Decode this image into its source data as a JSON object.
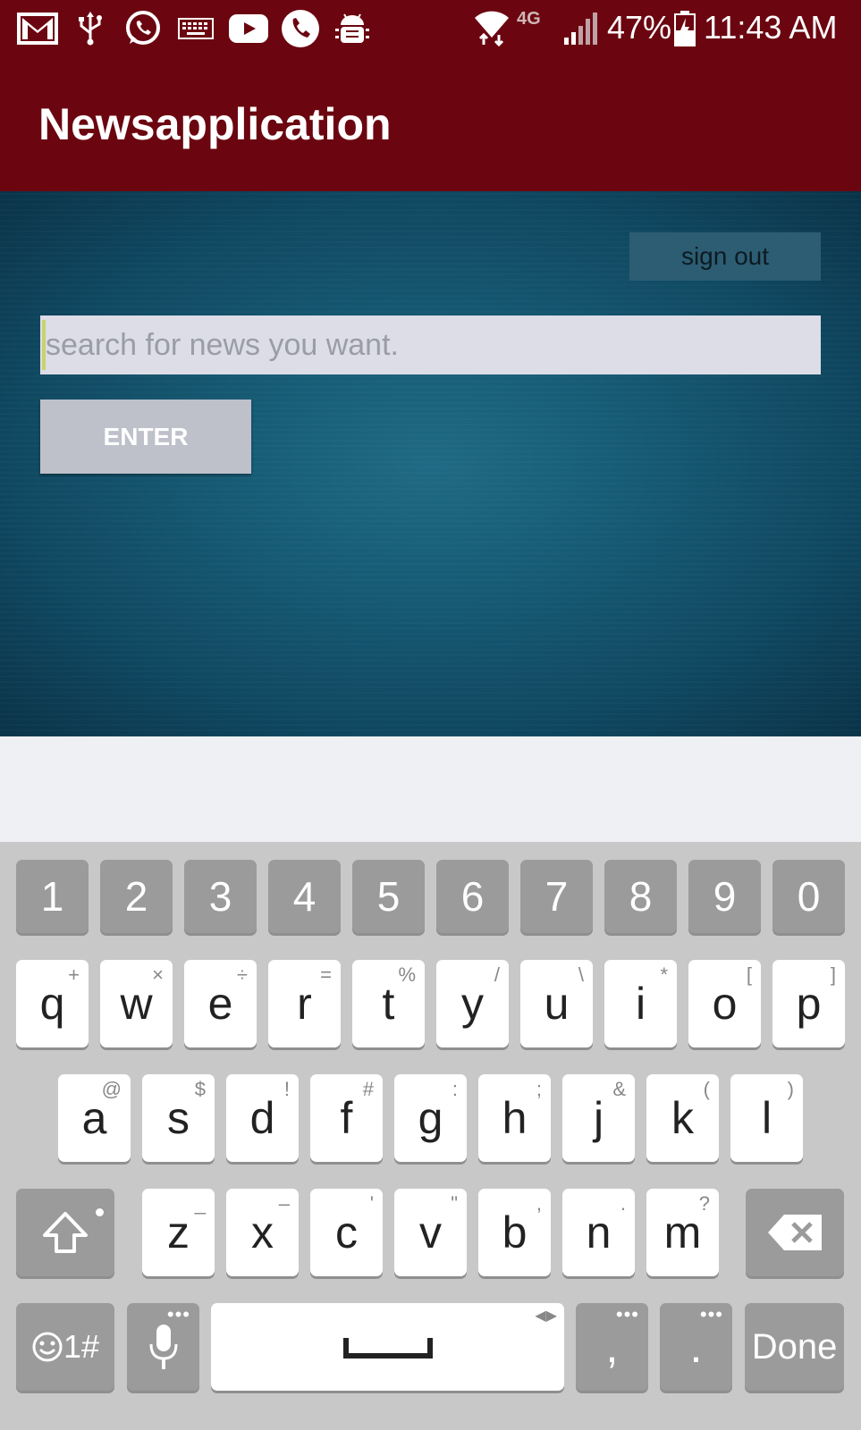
{
  "status_bar": {
    "icons": [
      "gmail-icon",
      "usb-icon",
      "whatsapp-icon",
      "keyboard-icon",
      "youtube-icon",
      "phone-icon",
      "android-debug-icon",
      "wifi-icon",
      "lte-4g-icon",
      "signal-icon",
      "battery-icon"
    ],
    "network": "4G",
    "battery_percent": "47%",
    "time": "11:43 AM"
  },
  "app_bar": {
    "title": "Newsapplication"
  },
  "main": {
    "sign_out_label": "sign out",
    "search_placeholder": "search for news you want.",
    "enter_label": "ENTER"
  },
  "keyboard": {
    "numbers": [
      "1",
      "2",
      "3",
      "4",
      "5",
      "6",
      "7",
      "8",
      "9",
      "0"
    ],
    "row1": [
      {
        "key": "q",
        "alt": "+"
      },
      {
        "key": "w",
        "alt": "×"
      },
      {
        "key": "e",
        "alt": "÷"
      },
      {
        "key": "r",
        "alt": "="
      },
      {
        "key": "t",
        "alt": "%"
      },
      {
        "key": "y",
        "alt": "/"
      },
      {
        "key": "u",
        "alt": "\\"
      },
      {
        "key": "i",
        "alt": "*"
      },
      {
        "key": "o",
        "alt": "["
      },
      {
        "key": "p",
        "alt": "]"
      }
    ],
    "row2": [
      {
        "key": "a",
        "alt": "@"
      },
      {
        "key": "s",
        "alt": "$"
      },
      {
        "key": "d",
        "alt": "!"
      },
      {
        "key": "f",
        "alt": "#"
      },
      {
        "key": "g",
        "alt": ":"
      },
      {
        "key": "h",
        "alt": ";"
      },
      {
        "key": "j",
        "alt": "&"
      },
      {
        "key": "k",
        "alt": "("
      },
      {
        "key": "l",
        "alt": ")"
      }
    ],
    "row3": [
      {
        "key": "z",
        "alt": "_"
      },
      {
        "key": "x",
        "alt": "–"
      },
      {
        "key": "c",
        "alt": "'"
      },
      {
        "key": "v",
        "alt": "\""
      },
      {
        "key": "b",
        "alt": ","
      },
      {
        "key": "n",
        "alt": "."
      },
      {
        "key": "m",
        "alt": "?"
      }
    ],
    "symbols_label": "1#",
    "comma_label": ",",
    "period_label": ".",
    "done_label": "Done"
  }
}
